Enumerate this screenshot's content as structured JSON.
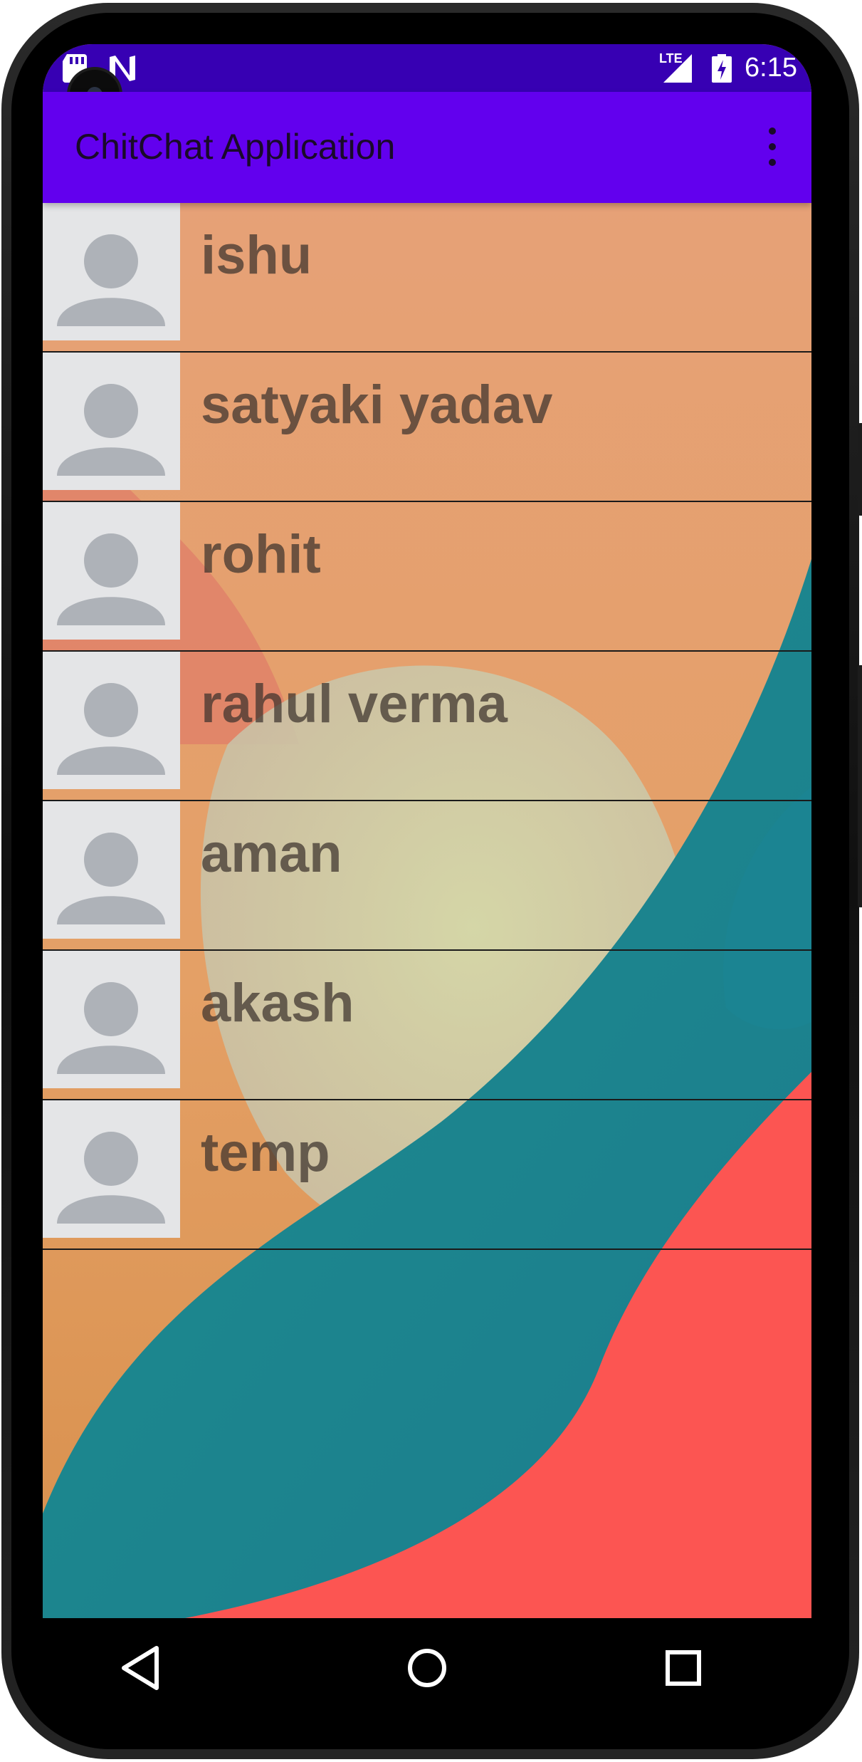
{
  "status_bar": {
    "time": "6:15",
    "network_label": "LTE",
    "left_icons": [
      "sd-card-icon",
      "n-notification-icon"
    ],
    "right_icons": [
      "lte-signal-icon",
      "battery-charging-icon"
    ]
  },
  "app_bar": {
    "title": "ChitChat Application",
    "overflow_icon": "more-vert-icon",
    "color": "#6200ee",
    "status_color": "#3700b3"
  },
  "contacts": [
    {
      "name": "ishu",
      "avatar_icon": "default-avatar-icon"
    },
    {
      "name": "satyaki yadav",
      "avatar_icon": "default-avatar-icon"
    },
    {
      "name": "rohit",
      "avatar_icon": "default-avatar-icon"
    },
    {
      "name": "rahul verma",
      "avatar_icon": "default-avatar-icon"
    },
    {
      "name": "aman",
      "avatar_icon": "default-avatar-icon"
    },
    {
      "name": "akash",
      "avatar_icon": "default-avatar-icon"
    },
    {
      "name": "temp",
      "avatar_icon": "default-avatar-icon"
    }
  ],
  "nav_bar": {
    "icons": [
      "back-icon",
      "home-icon",
      "recents-icon"
    ]
  }
}
